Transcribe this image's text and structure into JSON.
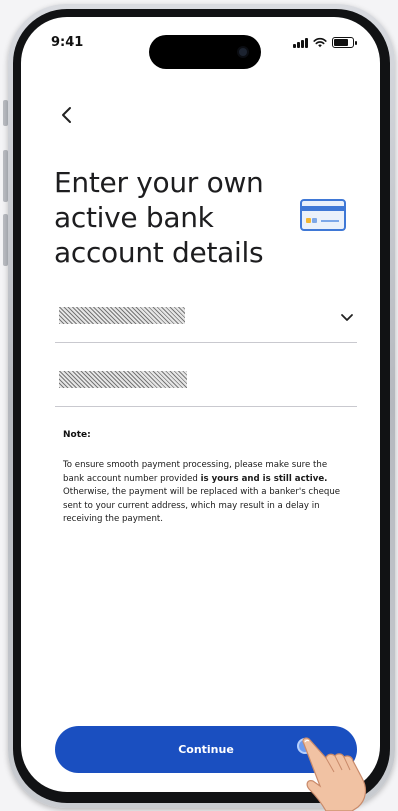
{
  "status_bar": {
    "time": "9:41"
  },
  "header": {
    "back_icon": "chevron-left-icon"
  },
  "page": {
    "title_lines": [
      "Enter your own",
      "active bank",
      "account details"
    ],
    "illustration_icon": "bank-card-icon"
  },
  "form": {
    "bank_field": {
      "value": "xxxxxxxxxxxxxxxxx",
      "dropdown_icon": "chevron-down-icon"
    },
    "account_number_field": {
      "value": "xxxxxxxxxxxxxxxxx"
    }
  },
  "note": {
    "title": "Note:",
    "text_1": "To ensure smooth payment processing, please make sure the bank account number provided ",
    "text_bold": "is yours and is still active.",
    "text_2": " Otherwise, the payment will be replaced with a banker's cheque sent to your current address, which may result in a delay in receiving the payment."
  },
  "footer": {
    "continue_label": "Continue"
  },
  "colors": {
    "primary": "#1a4fc0",
    "text": "#1d1d1f",
    "divider": "#c9c9cf"
  }
}
